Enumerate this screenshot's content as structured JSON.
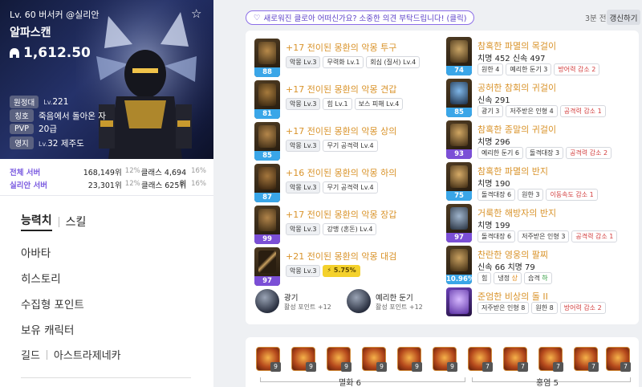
{
  "profile": {
    "level_line": "Lv. 60 버서커 @실리안",
    "name": "알파스캔",
    "item_level": "1,612.50",
    "rows": [
      {
        "tag": "원정대",
        "small": "Lv.",
        "value": "221"
      },
      {
        "tag": "칭호",
        "small": "",
        "value": "죽음에서 돌아온 자"
      },
      {
        "tag": "PVP",
        "small": "",
        "value": "20급"
      },
      {
        "tag": "영지",
        "small": "Lv.",
        "value": "32 제주도"
      }
    ],
    "ranking": [
      {
        "label": "전체 서버",
        "rank": "168,149위",
        "pct": "12%",
        "class_rank": "클래스 4,694위",
        "class_pct": "16%"
      },
      {
        "label": "실리안 서버",
        "rank": "23,301위",
        "pct": "12%",
        "class_rank": "클래스 625위",
        "class_pct": "16%"
      }
    ]
  },
  "menu": {
    "tab_active": "능력치",
    "tab_other": "스킬",
    "items": [
      "아바타",
      "히스토리",
      "수집형 포인트",
      "보유 캐릭터"
    ],
    "guild_label": "길드",
    "guild_name": "아스트라제네카"
  },
  "top": {
    "survey": "새로워진 클로아 어떠신가요? 소중한 의견 부탁드립니다! (클릭)",
    "updated": "3분 전",
    "refresh": "갱신하기"
  },
  "armor": [
    {
      "name": "+17 전이된 몽환의 악몽 투구",
      "quality": "88",
      "qclass": "q-blue",
      "chips": [
        {
          "t": "악몽 Lv.3",
          "c": "gray"
        },
        {
          "t": "무력화 Lv.1",
          "c": ""
        },
        {
          "t": "회심 (질서) Lv.4",
          "c": ""
        }
      ]
    },
    {
      "name": "+17 전이된 몽환의 악몽 견갑",
      "quality": "81",
      "qclass": "q-blue",
      "chips": [
        {
          "t": "악몽 Lv.3",
          "c": "gray"
        },
        {
          "t": "힘 Lv.1",
          "c": ""
        },
        {
          "t": "보스 피해 Lv.4",
          "c": ""
        }
      ]
    },
    {
      "name": "+17 전이된 몽환의 악몽 상의",
      "quality": "85",
      "qclass": "q-blue",
      "chips": [
        {
          "t": "악몽 Lv.3",
          "c": "gray"
        },
        {
          "t": "무기 공격력 Lv.4",
          "c": ""
        }
      ]
    },
    {
      "name": "+16 전이된 몽환의 악몽 하의",
      "quality": "87",
      "qclass": "q-blue",
      "chips": [
        {
          "t": "악몽 Lv.3",
          "c": "gray"
        },
        {
          "t": "무기 공격력 Lv.4",
          "c": ""
        }
      ]
    },
    {
      "name": "+17 전이된 몽환의 악몽 장갑",
      "quality": "99",
      "qclass": "q-purple",
      "chips": [
        {
          "t": "악몽 Lv.3",
          "c": "gray"
        },
        {
          "t": "강맹 (혼돈) Lv.4",
          "c": ""
        }
      ]
    },
    {
      "name": "+21 전이된 몽환의 악몽 대검",
      "quality": "97",
      "qclass": "q-purple",
      "chips": [
        {
          "t": "악몽 Lv.3",
          "c": "gray"
        },
        {
          "t": "⚡ 5.75%",
          "c": "yellow"
        }
      ]
    }
  ],
  "accessories": [
    {
      "name": "참혹한 파멸의 목걸이",
      "stat": "치명 452  신속 497",
      "quality": "74",
      "qclass": "q-blue",
      "chips": [
        {
          "t": "원한 4",
          "c": ""
        },
        {
          "t": "예리한 둔기 3",
          "c": ""
        },
        {
          "t": "방어력 감소 2",
          "c": "red"
        }
      ]
    },
    {
      "name": "공허한 참회의 귀걸이",
      "stat": "신속 291",
      "quality": "85",
      "qclass": "q-blue",
      "chips": [
        {
          "t": "광기 3",
          "c": ""
        },
        {
          "t": "저주받은 인형 4",
          "c": ""
        },
        {
          "t": "공격력 감소 1",
          "c": "red"
        }
      ]
    },
    {
      "name": "참혹한 종말의 귀걸이",
      "stat": "치명 296",
      "quality": "93",
      "qclass": "q-purple",
      "chips": [
        {
          "t": "예리한 둔기 6",
          "c": ""
        },
        {
          "t": "돌격대장 3",
          "c": ""
        },
        {
          "t": "공격력 감소 2",
          "c": "red"
        }
      ]
    },
    {
      "name": "참혹한 파멸의 반지",
      "stat": "치명 190",
      "quality": "75",
      "qclass": "q-blue",
      "chips": [
        {
          "t": "돌격대장 6",
          "c": ""
        },
        {
          "t": "원한 3",
          "c": ""
        },
        {
          "t": "이동속도 감소 1",
          "c": "red"
        }
      ]
    },
    {
      "name": "거룩한 해방자의 반지",
      "stat": "치명 199",
      "quality": "97",
      "qclass": "q-purple",
      "chips": [
        {
          "t": "돌격대장 6",
          "c": ""
        },
        {
          "t": "저주받은 인형 3",
          "c": ""
        },
        {
          "t": "공격력 감소 1",
          "c": "red"
        }
      ]
    },
    {
      "name": "찬란한 영웅의 팔찌",
      "stat": "신속 66  치명 79",
      "quality": "10.96%",
      "qclass": "q-blue",
      "chips": [
        {
          "t": "힘",
          "c": ""
        },
        {
          "t": "냉정 상",
          "c": ""
        },
        {
          "t": "습격 하",
          "c": ""
        }
      ]
    },
    {
      "name": "준엄한 비상의 돌 II",
      "stat": "",
      "quality": "",
      "qclass": "",
      "chips": [
        {
          "t": "저주받은 인형 8",
          "c": ""
        },
        {
          "t": "원한 8",
          "c": ""
        },
        {
          "t": "방어력 감소 2",
          "c": "red"
        }
      ]
    }
  ],
  "engravings": [
    {
      "name": "광기",
      "points": "활성 포인트 +12"
    },
    {
      "name": "예리한 둔기",
      "points": "활성 포인트 +12"
    }
  ],
  "gems": {
    "levels": [
      "9",
      "9",
      "9",
      "9",
      "9",
      "9",
      "7",
      "7",
      "7",
      "7",
      "7"
    ],
    "groups": [
      {
        "label": "멸화 6"
      },
      {
        "label": "홍염 5"
      }
    ]
  },
  "colors": {
    "accent": "#7b4fd6",
    "item_name": "#d9932a",
    "quality_blue": "#3aa6e8",
    "quality_purple": "#7b4fd6",
    "penalty": "#d23b3b"
  }
}
